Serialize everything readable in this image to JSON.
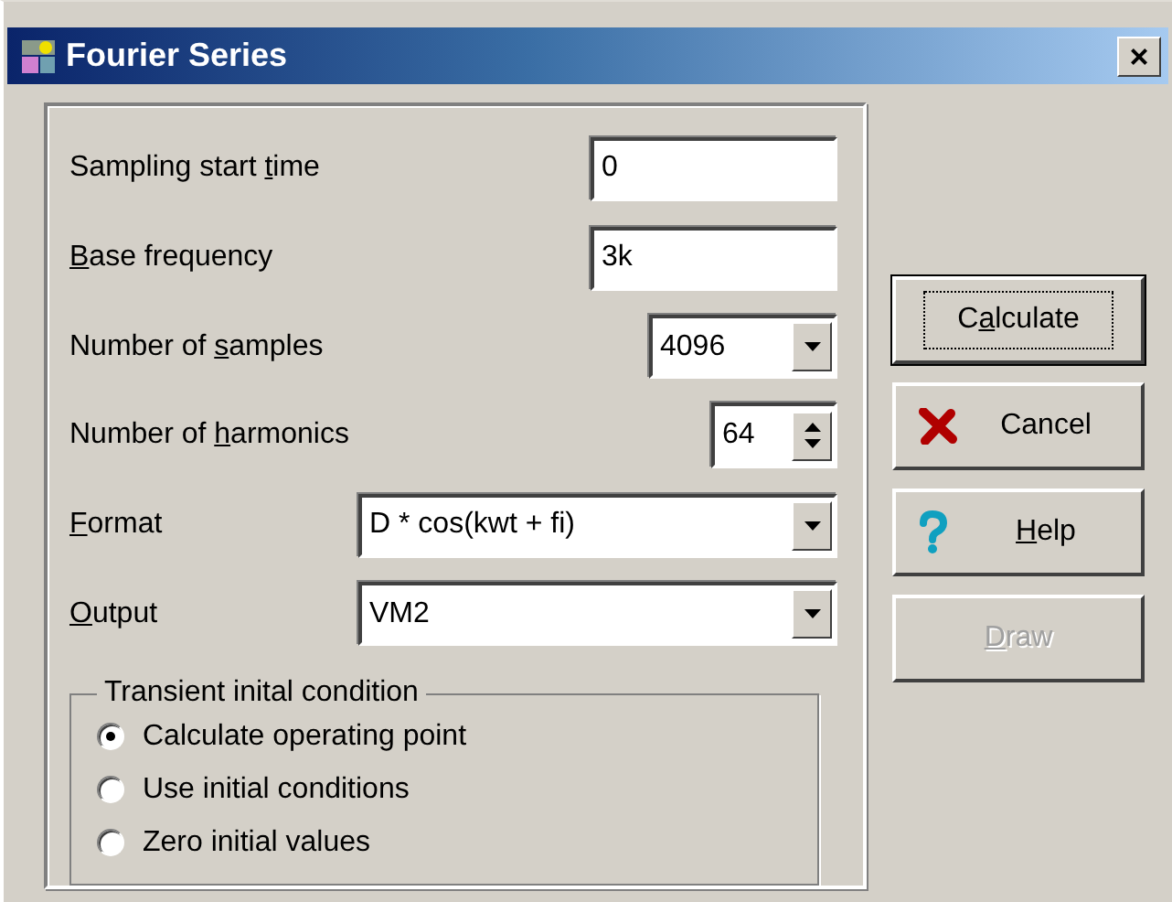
{
  "window": {
    "title": "Fourier Series",
    "close": "×"
  },
  "fields": [
    {
      "kind": "text",
      "label": {
        "before": "Sampling start ",
        "key": "t",
        "after": "ime"
      },
      "value": "0"
    },
    {
      "kind": "text",
      "label": {
        "key": "B",
        "after": "ase frequency"
      },
      "value": "3k"
    },
    {
      "kind": "combo",
      "label": {
        "before": "Number of ",
        "key": "s",
        "after": "amples"
      },
      "value": "4096"
    },
    {
      "kind": "spin",
      "label": {
        "before": "Number of ",
        "key": "h",
        "after": "armonics"
      },
      "value": "64"
    },
    {
      "kind": "widecombo",
      "label": {
        "key": "F",
        "after": "ormat"
      },
      "value": "D * cos(kwt + fi)"
    },
    {
      "kind": "widecombo",
      "label": {
        "key": "O",
        "after": "utput"
      },
      "value": "VM2"
    }
  ],
  "group": {
    "title": "Transient inital condition",
    "options": [
      {
        "label": "Calculate operating point",
        "selected": true
      },
      {
        "label": "Use initial conditions",
        "selected": false
      },
      {
        "label": "Zero initial values",
        "selected": false
      }
    ]
  },
  "buttons": [
    {
      "kind": "plain",
      "label": {
        "before": "C",
        "key": "a",
        "after": "lculate"
      },
      "default": true,
      "disabled": false
    },
    {
      "kind": "cancel",
      "label": {
        "before": "Cancel"
      },
      "default": false,
      "disabled": false
    },
    {
      "kind": "help",
      "label": {
        "key": "H",
        "after": "elp"
      },
      "default": false,
      "disabled": false
    },
    {
      "kind": "plain",
      "label": {
        "key": "D",
        "after": "raw"
      },
      "default": false,
      "disabled": true
    }
  ]
}
